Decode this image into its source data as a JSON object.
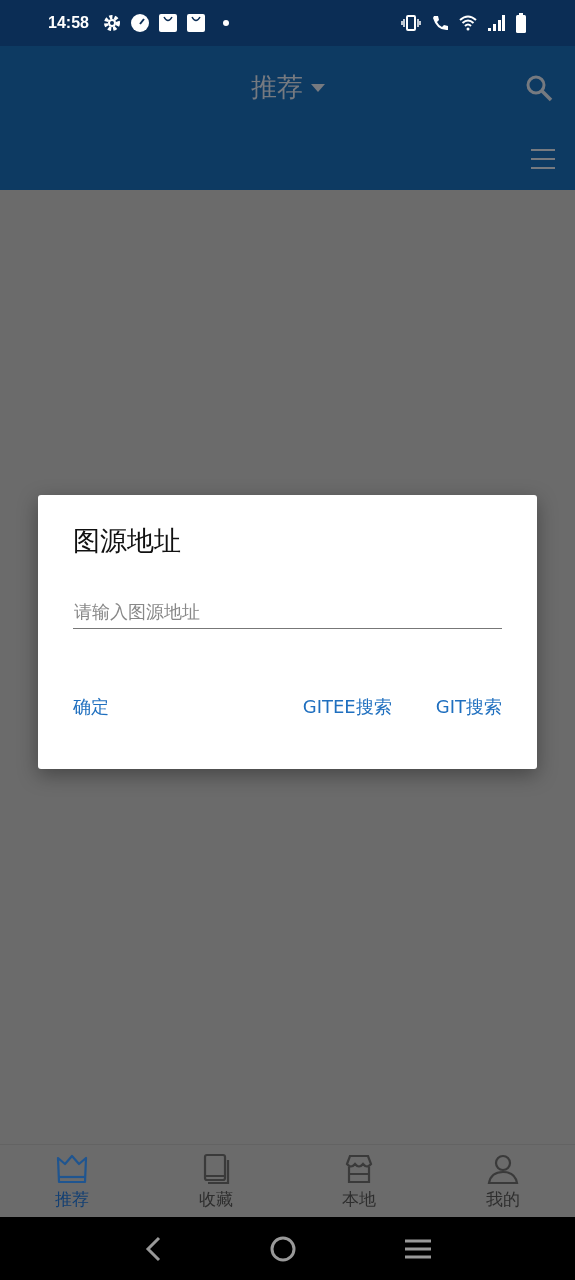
{
  "status_bar": {
    "time": "14:58"
  },
  "app_bar": {
    "title": "推荐"
  },
  "dialog": {
    "title": "图源地址",
    "field": {
      "placeholder": "请输入图源地址"
    },
    "buttons": [
      {
        "label": "确定",
        "kind": "left"
      },
      {
        "label": "GITEE搜索",
        "kind": "right"
      },
      {
        "label": "GIT搜索",
        "kind": "right"
      }
    ]
  },
  "bottom_nav": [
    {
      "label": "推荐",
      "kind": "crown",
      "selected": true
    },
    {
      "label": "收藏",
      "kind": "book",
      "selected": false
    },
    {
      "label": "本地",
      "kind": "store",
      "selected": false
    },
    {
      "label": "我的",
      "kind": "person",
      "selected": false
    }
  ]
}
